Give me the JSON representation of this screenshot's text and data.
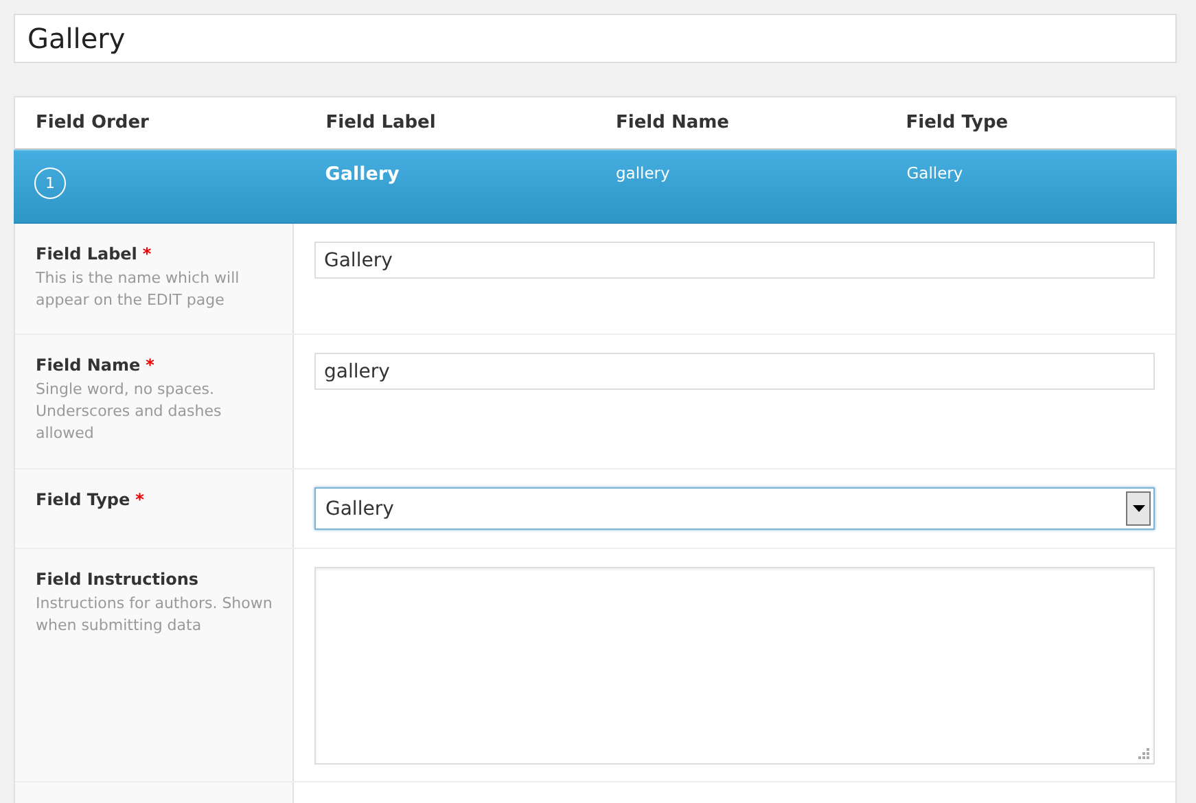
{
  "title_field": {
    "value": "Gallery"
  },
  "table": {
    "columns": [
      "Field Order",
      "Field Label",
      "Field Name",
      "Field Type"
    ],
    "rows": [
      {
        "order": "1",
        "label": "Gallery",
        "name": "gallery",
        "type": "Gallery",
        "selected": true
      }
    ]
  },
  "settings": [
    {
      "kind": "text",
      "label": "Field Label",
      "required_mark": "*",
      "description": "This is the name which will appear on the EDIT page",
      "value": "Gallery"
    },
    {
      "kind": "text",
      "label": "Field Name",
      "required_mark": "*",
      "description": "Single word, no spaces. Underscores and dashes allowed",
      "value": "gallery"
    },
    {
      "kind": "select",
      "label": "Field Type",
      "required_mark": "*",
      "value": "Gallery"
    },
    {
      "kind": "textarea",
      "label": "Field Instructions",
      "description": "Instructions for authors. Shown when submitting data"
    },
    {
      "kind": "empty"
    }
  ]
}
